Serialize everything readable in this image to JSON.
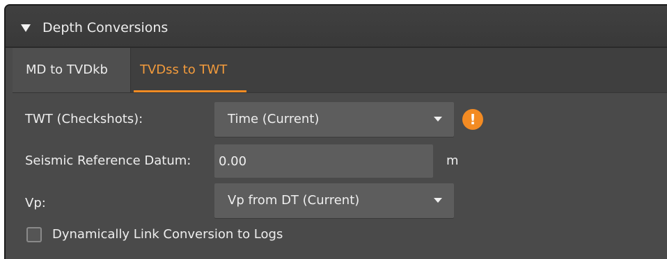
{
  "panel": {
    "title": "Depth Conversions",
    "collapse_icon": "triangle-down-icon"
  },
  "tabs": [
    {
      "label": "MD to TVDkb",
      "active": false
    },
    {
      "label": "TVDss to TWT",
      "active": true
    }
  ],
  "form": {
    "twt": {
      "label": "TWT (Checkshots):",
      "value": "Time (Current)",
      "warning_icon": "warning-icon",
      "warning_glyph": "!"
    },
    "datum": {
      "label": "Seismic Reference Datum:",
      "value": "0.00",
      "unit": "m"
    },
    "vp": {
      "label": "Vp:",
      "value": "Vp from DT (Current)"
    },
    "dynamic_link": {
      "label": "Dynamically Link Conversion to Logs",
      "checked": false
    }
  },
  "colors": {
    "accent": "#f38b23",
    "panel_bg": "#4a4a4a",
    "field_bg": "#5d5d5d"
  }
}
